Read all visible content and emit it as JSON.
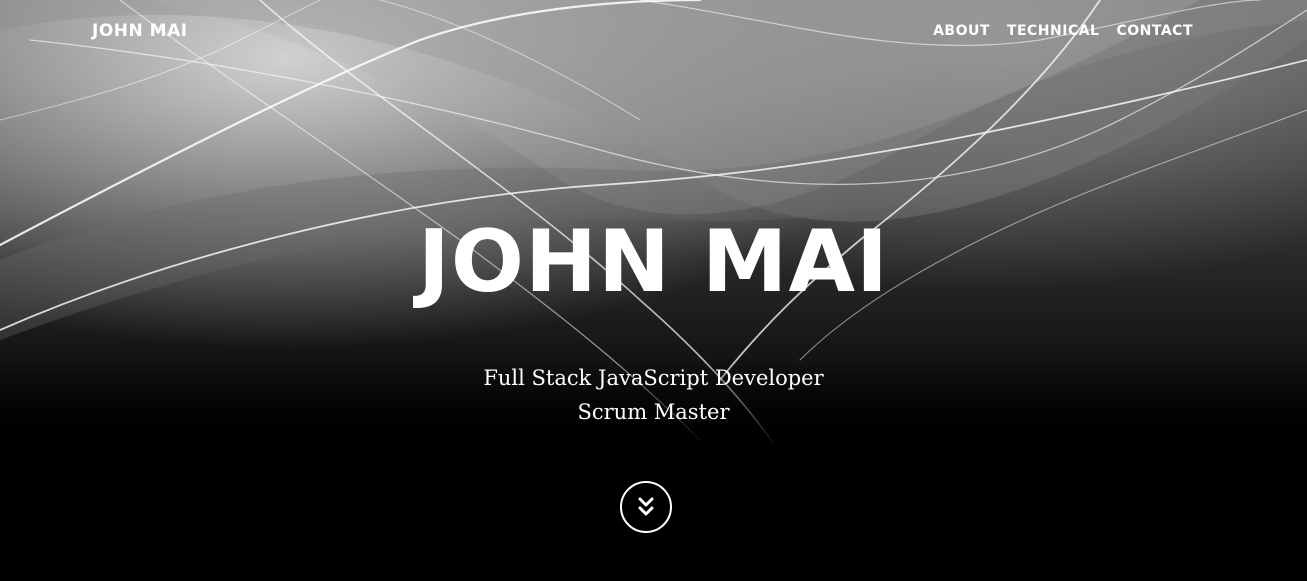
{
  "navbar": {
    "brand": "JOHN MAI",
    "links": [
      {
        "label": "ABOUT"
      },
      {
        "label": "TECHNICAL"
      },
      {
        "label": "CONTACT"
      }
    ]
  },
  "hero": {
    "title": "JOHN MAI",
    "subtitles": [
      "Full Stack JavaScript Developer",
      "Scrum Master"
    ]
  },
  "scroll_button": {
    "icon": "double-chevron-down-icon"
  }
}
